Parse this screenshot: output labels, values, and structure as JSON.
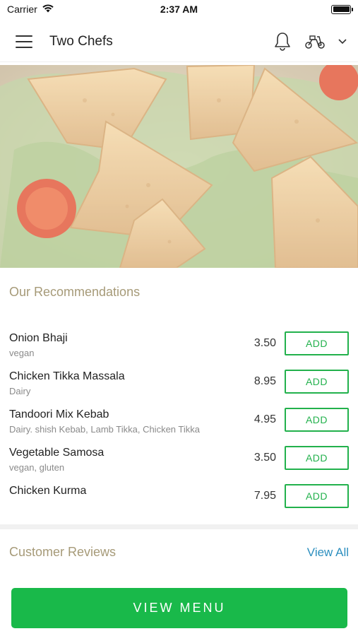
{
  "status_bar": {
    "carrier": "Carrier",
    "time": "2:37 AM",
    "battery_level": 1.0
  },
  "header": {
    "title": "Two Chefs",
    "icons": [
      "menu-icon",
      "bell-icon",
      "scooter-icon",
      "chevron-down-icon"
    ]
  },
  "hero": {
    "subject": "samosas on lettuce with tomato slices"
  },
  "recommendations": {
    "title": "Our Recommendations",
    "add_label": "ADD",
    "items": [
      {
        "name": "Onion Bhaji",
        "desc": "vegan",
        "price": "3.50"
      },
      {
        "name": "Chicken Tikka Massala",
        "desc": "Dairy",
        "price": "8.95"
      },
      {
        "name": "Tandoori Mix Kebab",
        "desc": "Dairy.  shish Kebab, Lamb Tikka, Chicken Tikka",
        "price": "4.95"
      },
      {
        "name": "Vegetable Samosa",
        "desc": "vegan, gluten",
        "price": "3.50"
      },
      {
        "name": "Chicken Kurma",
        "desc": "",
        "price": "7.95"
      }
    ]
  },
  "reviews": {
    "title": "Customer Reviews",
    "view_all": "View All"
  },
  "footer": {
    "view_menu": "VIEW MENU"
  },
  "colors": {
    "accent_green": "#19b94a",
    "section_title": "#a69a78",
    "link_blue": "#2d8fbf"
  }
}
